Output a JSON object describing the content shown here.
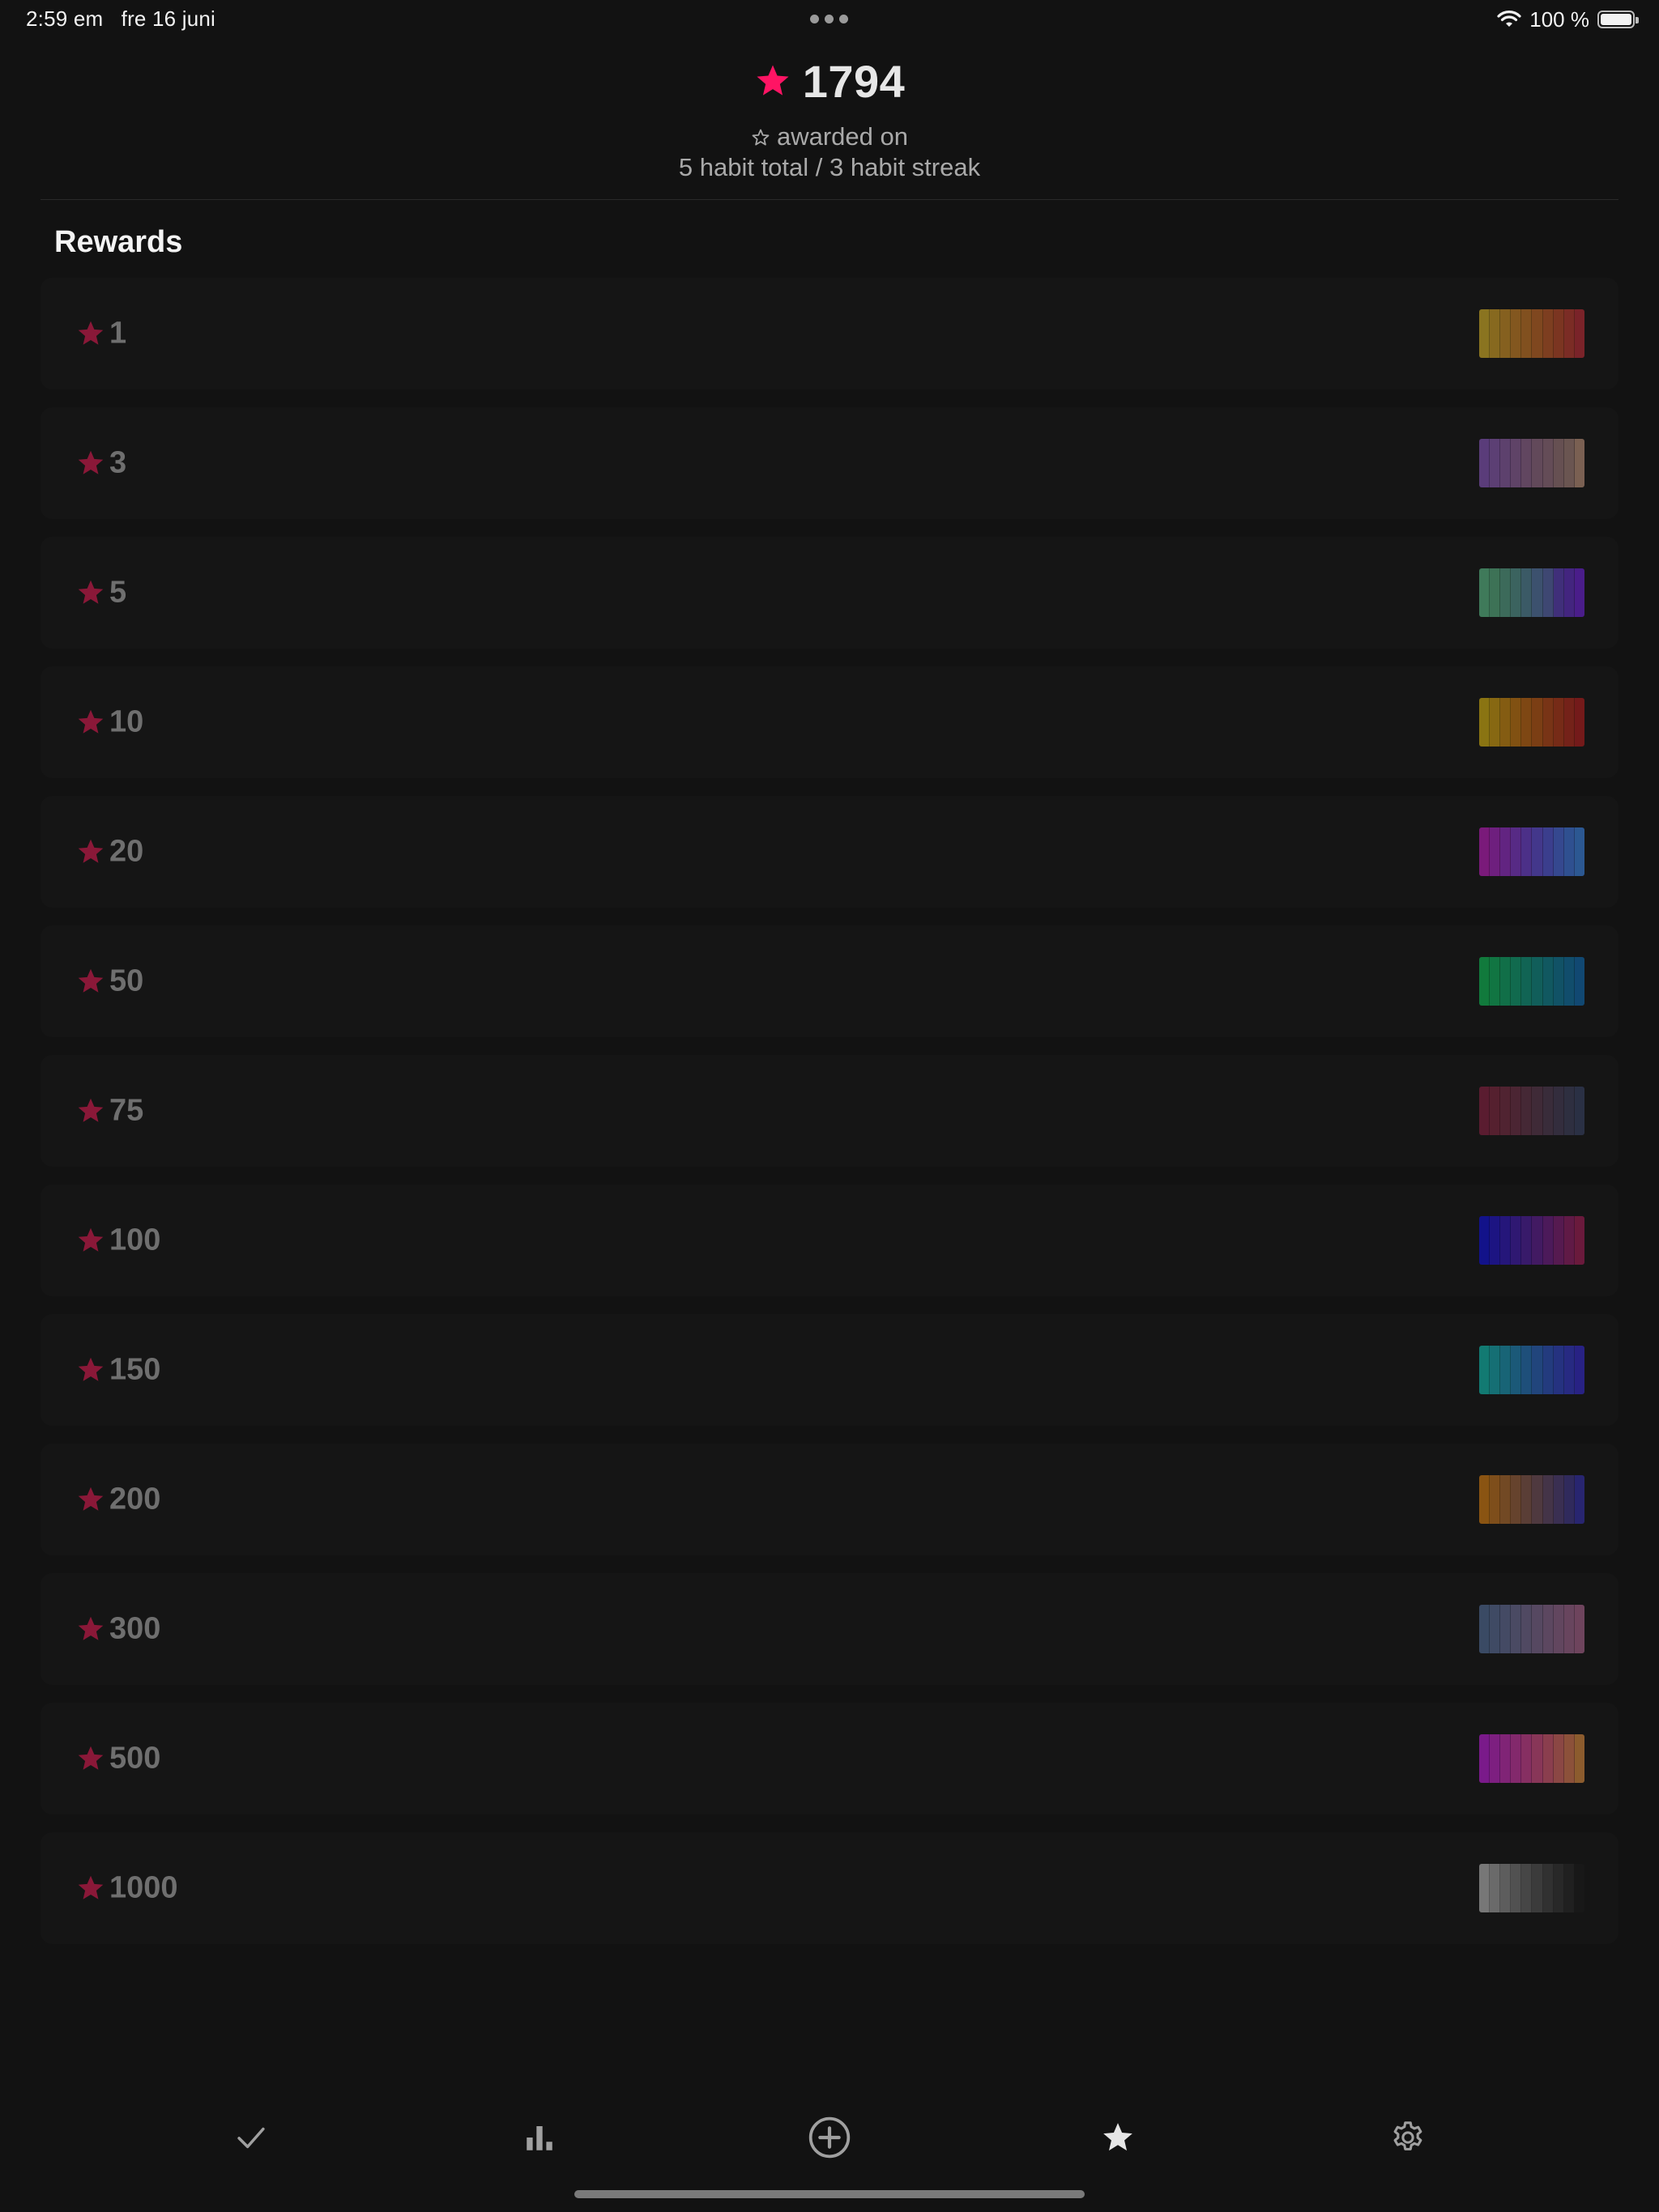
{
  "status_bar": {
    "time": "2:59 em",
    "date": "fre 16 juni",
    "battery": "100 %"
  },
  "header": {
    "points": "1794",
    "awarded_label": "awarded on",
    "rules": "5 habit total / 3 habit streak",
    "accent_color": "#ff1464"
  },
  "rewards": {
    "title": "Rewards",
    "star_color": "#8a1838",
    "items": [
      {
        "count": "1",
        "colors": [
          "#8a7420",
          "#87691f",
          "#85601f",
          "#83571f",
          "#81501f",
          "#7f471f",
          "#7d3e20",
          "#7b3521",
          "#7b2c25",
          "#7a2329"
        ]
      },
      {
        "count": "3",
        "colors": [
          "#5a3c7a",
          "#5c3f74",
          "#5d416d",
          "#5f4367",
          "#614660",
          "#62495a",
          "#644c57",
          "#665052",
          "#6a5551",
          "#7a6052"
        ]
      },
      {
        "count": "5",
        "colors": [
          "#3f7a5a",
          "#3d7256",
          "#3c6a5a",
          "#3b635f",
          "#3b5a66",
          "#3c516e",
          "#3e4772",
          "#402f7a",
          "#43257f",
          "#4a1d8a"
        ]
      },
      {
        "count": "10",
        "colors": [
          "#8a7412",
          "#876812",
          "#845c12",
          "#815112",
          "#7e4713",
          "#7b3e14",
          "#783416",
          "#762b17",
          "#742219",
          "#741a1a"
        ]
      },
      {
        "count": "20",
        "colors": [
          "#7a1a7a",
          "#6e1f7e",
          "#622481",
          "#572a85",
          "#4c3088",
          "#43378b",
          "#3b3e8d",
          "#35488f",
          "#2f5090",
          "#2c5892"
        ]
      },
      {
        "count": "50",
        "colors": [
          "#117a3c",
          "#117542",
          "#116f48",
          "#116a4e",
          "#116454",
          "#115e5a",
          "#115860",
          "#115266",
          "#114d6c",
          "#114872"
        ]
      },
      {
        "count": "75",
        "colors": [
          "#5a1c30",
          "#55202f",
          "#502331",
          "#4b2533",
          "#452835",
          "#3f2a37",
          "#392c3a",
          "#332d3d",
          "#2e2f40",
          "#2a3044"
        ]
      },
      {
        "count": "100",
        "colors": [
          "#12128a",
          "#1c1482",
          "#25167a",
          "#2f1872",
          "#381a6a",
          "#421a62",
          "#4c1a5a",
          "#561a50",
          "#601a46",
          "#6a1a3c"
        ]
      },
      {
        "count": "150",
        "colors": [
          "#127a72",
          "#156f74",
          "#186476",
          "#1b5978",
          "#1e4f7a",
          "#21457c",
          "#233b7e",
          "#253280",
          "#272a82",
          "#282284"
        ]
      },
      {
        "count": "200",
        "colors": [
          "#8a5412",
          "#7e4e1b",
          "#724924",
          "#66432d",
          "#5a3e36",
          "#4f393f",
          "#443448",
          "#3a2f52",
          "#302a5c",
          "#282570"
        ]
      },
      {
        "count": "300",
        "colors": [
          "#3a4a64",
          "#3f4a64",
          "#444a64",
          "#4a4a63",
          "#504962",
          "#564861",
          "#5c4760",
          "#62465f",
          "#68455e",
          "#6e445d"
        ]
      },
      {
        "count": "500",
        "colors": [
          "#7a1a8a",
          "#7d1f80",
          "#802476",
          "#83296c",
          "#862f62",
          "#883658",
          "#8a3e4e",
          "#8b4744",
          "#8c513a",
          "#8c5c2e"
        ]
      },
      {
        "count": "1000",
        "colors": [
          "#777777",
          "#6a6a6a",
          "#5d5d5d",
          "#515151",
          "#464646",
          "#3b3b3b",
          "#313131",
          "#282828",
          "#202020",
          "#181818"
        ]
      }
    ]
  },
  "tabs": [
    {
      "name": "checkmark-icon"
    },
    {
      "name": "bar-chart-icon"
    },
    {
      "name": "plus-circle-icon"
    },
    {
      "name": "star-icon"
    },
    {
      "name": "gear-icon"
    }
  ]
}
